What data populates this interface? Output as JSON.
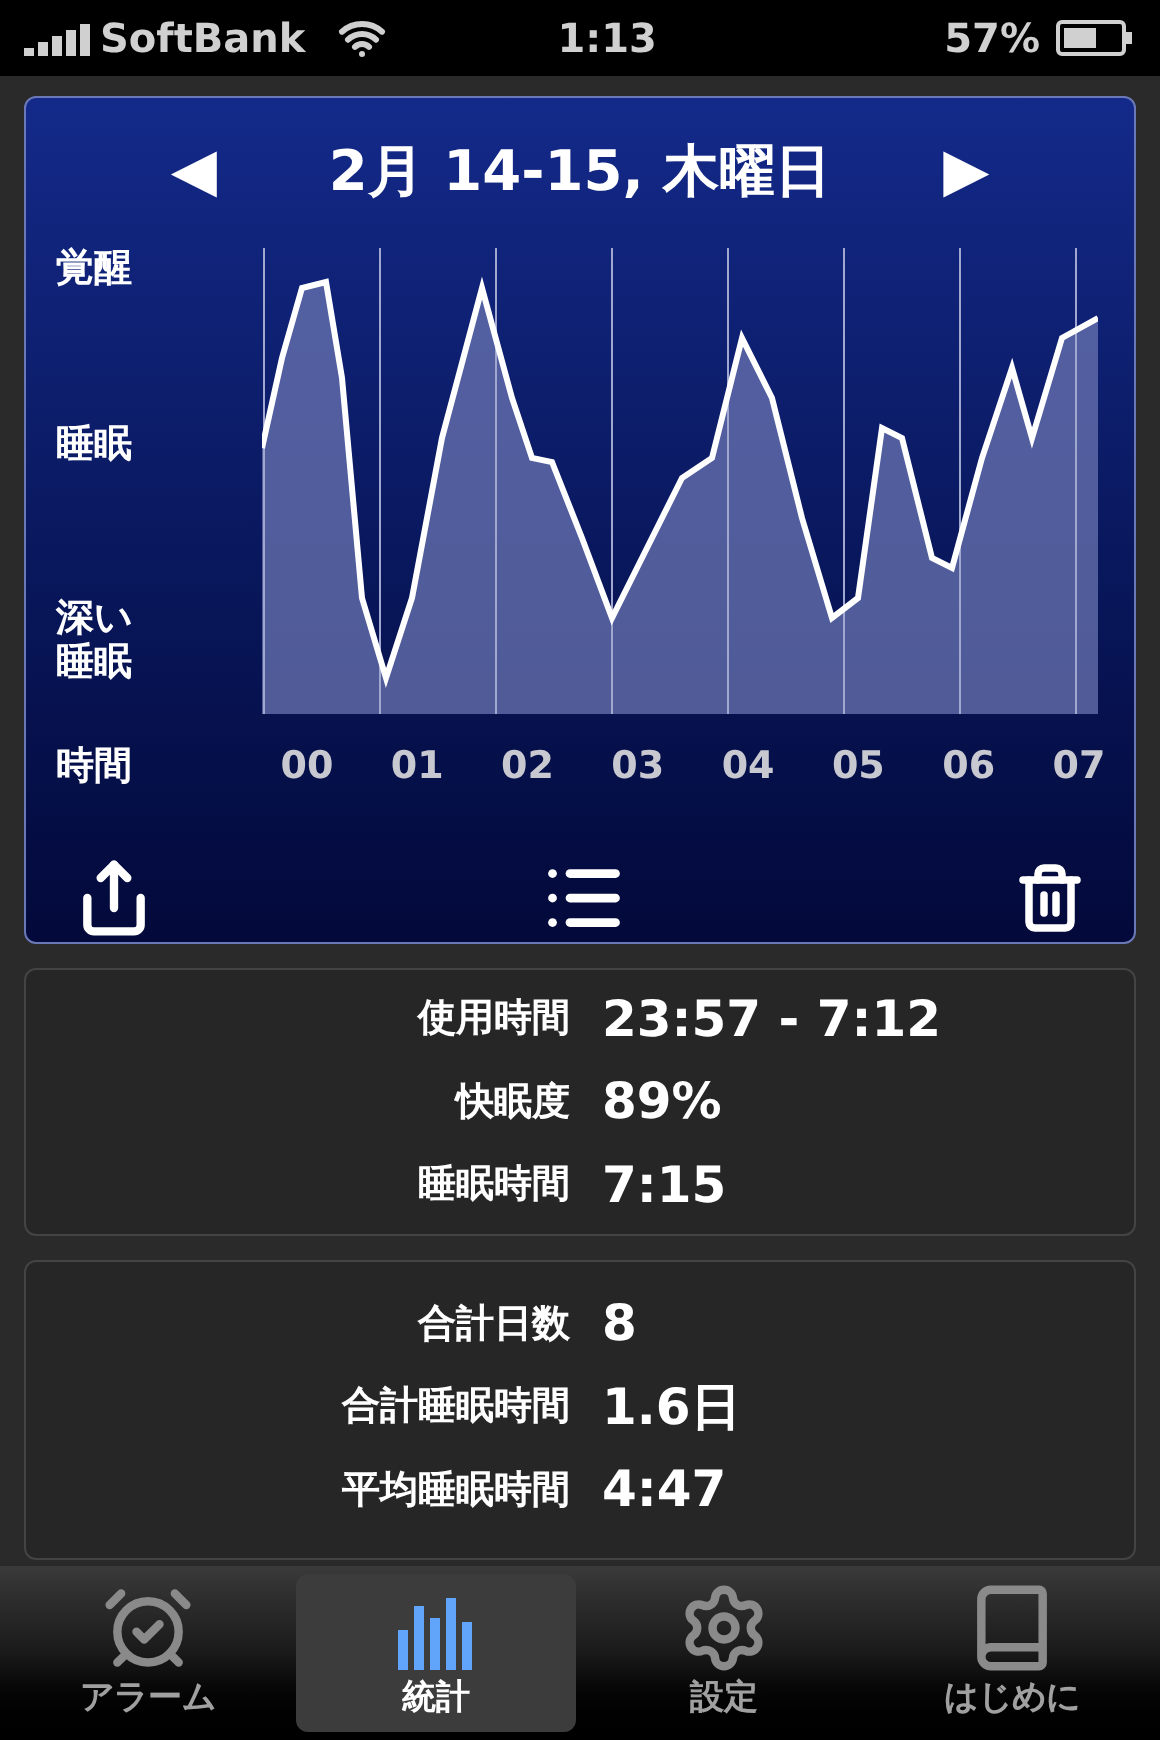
{
  "status_bar": {
    "carrier": "SoftBank",
    "time": "1:13",
    "battery": "57%"
  },
  "chart_card": {
    "title": "2月 14-15, 木曜日",
    "prev": "◀",
    "next": "▶",
    "y_labels": [
      "覚醒",
      "睡眠",
      "深い睡眠"
    ],
    "x_title": "時間",
    "hours": [
      "00",
      "01",
      "02",
      "03",
      "04",
      "05",
      "06",
      "07"
    ]
  },
  "session_stats": [
    {
      "label": "使用時間",
      "value": "23:57 - 7:12"
    },
    {
      "label": "快眠度",
      "value": "89%"
    },
    {
      "label": "睡眠時間",
      "value": "7:15"
    }
  ],
  "totals": [
    {
      "label": "合計日数",
      "value": "8"
    },
    {
      "label": "合計睡眠時間",
      "value": "1.6日"
    },
    {
      "label": "平均睡眠時間",
      "value": "4:47"
    }
  ],
  "tabs": [
    {
      "label": "アラーム",
      "kind": "alarm",
      "selected": false
    },
    {
      "label": "統計",
      "kind": "stats",
      "selected": true
    },
    {
      "label": "設定",
      "kind": "settings",
      "selected": false
    },
    {
      "label": "はじめに",
      "kind": "guide",
      "selected": false
    }
  ]
}
